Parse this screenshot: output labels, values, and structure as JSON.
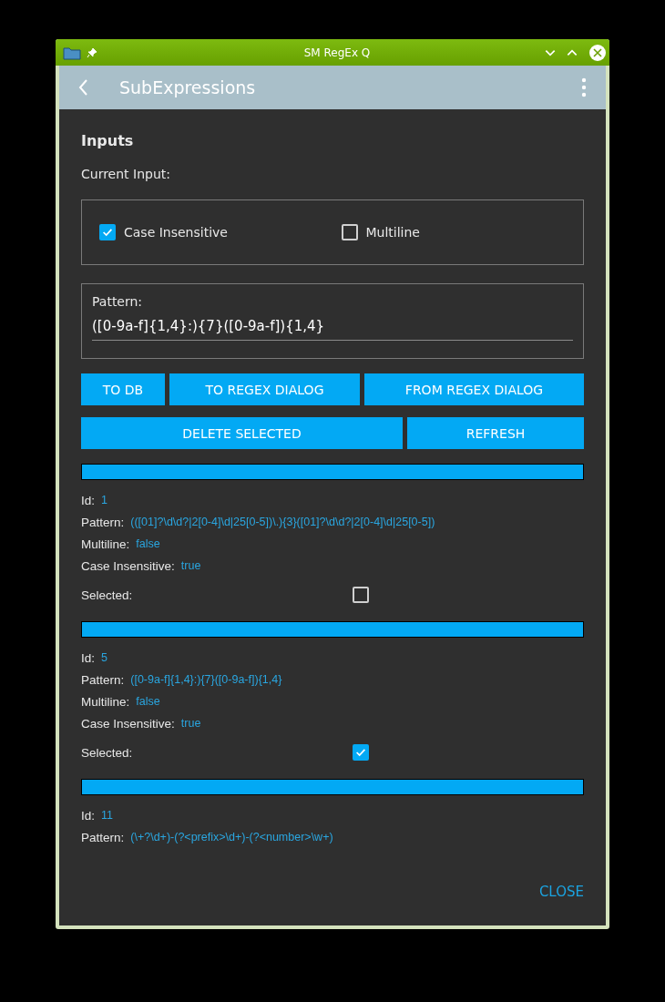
{
  "window": {
    "title": "SM RegEx Q"
  },
  "app_bar": {
    "title": "SubExpressions"
  },
  "inputs": {
    "heading": "Inputs",
    "current_input_label": "Current Input:",
    "options": [
      {
        "label": "Case Insensitive",
        "checked": true
      },
      {
        "label": "Multiline",
        "checked": false
      }
    ],
    "pattern": {
      "label": "Pattern:",
      "value": "([0-9a-f]{1,4}:){7}([0-9a-f]){1,4}"
    }
  },
  "buttons_row_1": [
    "TO DB",
    "TO REGEX DIALOG",
    "FROM REGEX DIALOG"
  ],
  "buttons_row_2": [
    "DELETE SELECTED",
    "REFRESH"
  ],
  "records": [
    {
      "fields": [
        {
          "label": "Id:",
          "value": "1"
        },
        {
          "label": "Pattern:",
          "value": "(([01]?\\d\\d?|2[0-4]\\d|25[0-5])\\.){3}([01]?\\d\\d?|2[0-4]\\d|25[0-5])"
        },
        {
          "label": "Multiline:",
          "value": "false"
        },
        {
          "label": "Case Insensitive:",
          "value": "true"
        }
      ],
      "selected_label": "Selected:",
      "selected": false
    },
    {
      "fields": [
        {
          "label": "Id:",
          "value": "5"
        },
        {
          "label": "Pattern:",
          "value": "([0-9a-f]{1,4}:){7}([0-9a-f]){1,4}"
        },
        {
          "label": "Multiline:",
          "value": "false"
        },
        {
          "label": "Case Insensitive:",
          "value": "true"
        }
      ],
      "selected_label": "Selected:",
      "selected": true
    },
    {
      "fields": [
        {
          "label": "Id:",
          "value": "11"
        },
        {
          "label": "Pattern:",
          "value": "(\\+?\\d+)-(?<prefix>\\d+)-(?<number>\\w+)"
        }
      ]
    }
  ],
  "close_button": "CLOSE"
}
